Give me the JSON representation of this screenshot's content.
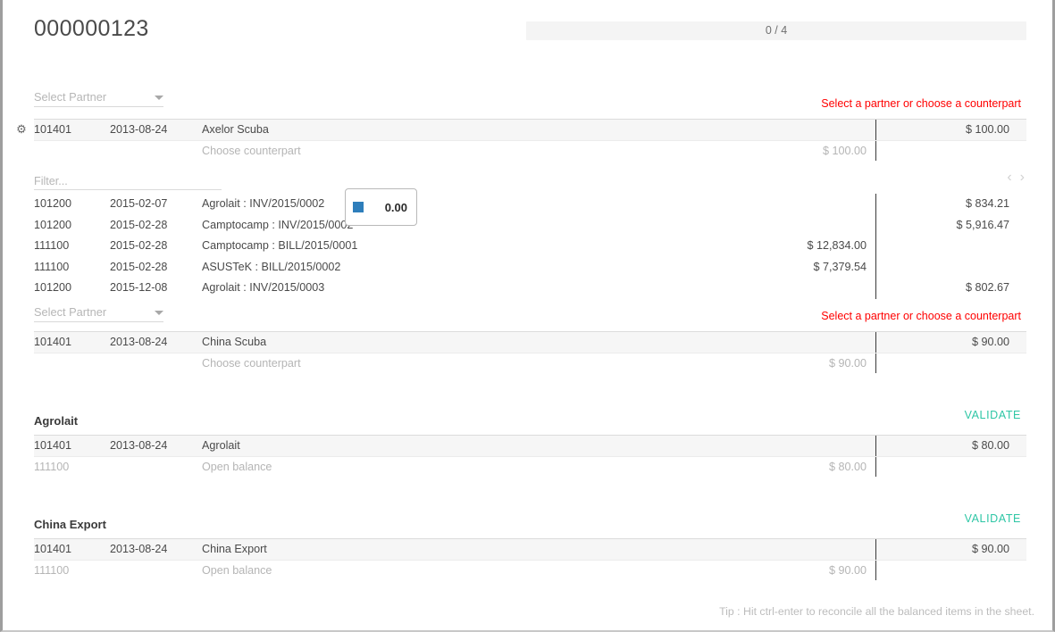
{
  "header": {
    "title": "000000123",
    "progress_label": "0 / 4"
  },
  "popup": {
    "icon": "blue-square-swatch",
    "amount": "0.00",
    "color": "#2e7ebb"
  },
  "colors": {
    "warning": "#ff0000",
    "validate": "#2ec6a5",
    "selected_row": "#f6f6f6"
  },
  "sections": [
    {
      "id": "axelor-scuba",
      "partner_placeholder": "Select Partner",
      "notice": "Select a partner or choose a counterpart",
      "notice_type": "warning",
      "lines": [
        {
          "account": "101401",
          "date": "2013-08-24",
          "label": "Axelor Scuba",
          "debit": "",
          "credit": "$ 100.00",
          "selected": true,
          "muted": false,
          "has_gear": true,
          "has_info": true
        },
        {
          "account": "",
          "date": "",
          "label": "Choose counterpart",
          "debit": "$ 100.00",
          "credit": "",
          "selected": false,
          "muted": true,
          "has_gear": false,
          "has_info": false
        }
      ],
      "proposals": {
        "filter_placeholder": "Filter...",
        "pager_prev": "‹",
        "pager_next": "›",
        "rows": [
          {
            "account": "101200",
            "date": "2015-02-07",
            "label": "Agrolait : INV/2015/0002",
            "debit": "",
            "credit": "$ 834.21",
            "has_info": true
          },
          {
            "account": "101200",
            "date": "2015-02-28",
            "label": "Camptocamp : INV/2015/0002",
            "debit": "",
            "credit": "$ 5,916.47",
            "has_info": true
          },
          {
            "account": "111100",
            "date": "2015-02-28",
            "label": "Camptocamp : BILL/2015/0001",
            "debit": "$ 12,834.00",
            "credit": "",
            "has_info": true
          },
          {
            "account": "111100",
            "date": "2015-02-28",
            "label": "ASUSTeK : BILL/2015/0002",
            "debit": "$ 7,379.54",
            "credit": "",
            "has_info": true
          },
          {
            "account": "101200",
            "date": "2015-12-08",
            "label": "Agrolait : INV/2015/0003",
            "debit": "",
            "credit": "$ 802.67",
            "has_info": true
          }
        ]
      }
    },
    {
      "id": "china-scuba",
      "partner_placeholder": "Select Partner",
      "notice": "Select a partner or choose a counterpart",
      "notice_type": "warning",
      "lines": [
        {
          "account": "101401",
          "date": "2013-08-24",
          "label": "China Scuba",
          "debit": "",
          "credit": "$ 90.00",
          "selected": true,
          "muted": false,
          "has_gear": false,
          "has_info": true
        },
        {
          "account": "",
          "date": "",
          "label": "Choose counterpart",
          "debit": "$ 90.00",
          "credit": "",
          "selected": false,
          "muted": true,
          "has_gear": false,
          "has_info": false
        }
      ]
    },
    {
      "id": "agrolait",
      "group_title": "Agrolait",
      "notice": "VALIDATE",
      "notice_type": "validate",
      "lines": [
        {
          "account": "101401",
          "date": "2013-08-24",
          "label": "Agrolait",
          "debit": "",
          "credit": "$ 80.00",
          "selected": true,
          "muted": false,
          "has_gear": false,
          "has_info": true
        },
        {
          "account": "111100",
          "date": "",
          "label": "Open balance",
          "debit": "$ 80.00",
          "credit": "",
          "selected": false,
          "muted": true,
          "has_gear": false,
          "has_info": false
        }
      ]
    },
    {
      "id": "china-export",
      "group_title": "China Export",
      "notice": "VALIDATE",
      "notice_type": "validate",
      "lines": [
        {
          "account": "101401",
          "date": "2013-08-24",
          "label": "China Export",
          "debit": "",
          "credit": "$ 90.00",
          "selected": true,
          "muted": false,
          "has_gear": false,
          "has_info": true
        },
        {
          "account": "111100",
          "date": "",
          "label": "Open balance",
          "debit": "$ 90.00",
          "credit": "",
          "selected": false,
          "muted": true,
          "has_gear": false,
          "has_info": false
        }
      ]
    }
  ],
  "footer": {
    "tip": "Tip : Hit ctrl-enter to reconcile all the balanced items in the sheet."
  }
}
